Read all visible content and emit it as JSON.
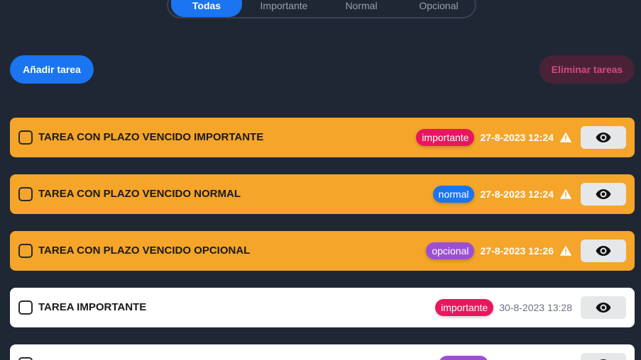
{
  "filters": {
    "items": [
      "Todas",
      "Importante",
      "Normal",
      "Opcional"
    ],
    "active": "Todas"
  },
  "toolbar": {
    "add_label": "Añadir tarea",
    "delete_label": "Eliminar tareas"
  },
  "colors": {
    "background": "#1f2735",
    "accent": "#1b74f0",
    "overdue": "#f4a52a",
    "importante": "#e8175d",
    "normal": "#1b74f0",
    "opcional": "#9b4fd6"
  },
  "tasks": [
    {
      "title": "TAREA CON PLAZO VENCIDO IMPORTANTE",
      "tag": "importante",
      "date": "27-8-2023 12:24",
      "overdue": true,
      "warning_icon": "warning-icon"
    },
    {
      "title": "TAREA CON PLAZO VENCIDO NORMAL",
      "tag": "normal",
      "date": "27-8-2023 12:24",
      "overdue": true,
      "warning_icon": "warning-icon"
    },
    {
      "title": "TAREA CON PLAZO VENCIDO OPCIONAL",
      "tag": "opcional",
      "date": "27-8-2023 12:26",
      "overdue": true,
      "warning_icon": "warning-icon"
    },
    {
      "title": "TAREA IMPORTANTE",
      "tag": "importante",
      "date": "30-8-2023 13:28",
      "overdue": false
    },
    {
      "title": "",
      "tag": "",
      "date": "",
      "overdue": false
    }
  ]
}
